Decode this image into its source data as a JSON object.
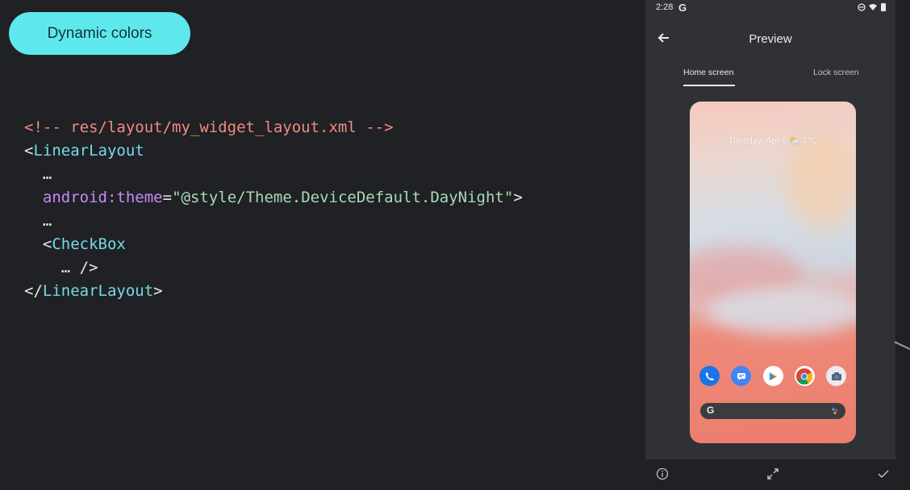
{
  "slide": {
    "badge": "Dynamic colors",
    "code": {
      "line1": "<!-- res/layout/my_widget_layout.xml -->",
      "line2_open": "<",
      "line2_tag": "LinearLayout",
      "line3": "…",
      "line4_attr": "android:theme",
      "line4_eq": "=",
      "line4_value": "\"@style/Theme.DeviceDefault.DayNight\"",
      "line4_close": ">",
      "line5": "…",
      "line6_open": "<",
      "line6_tag": "CheckBox",
      "line7": "… />",
      "line8_open": "</",
      "line8_tag": "LinearLayout",
      "line8_close": ">"
    }
  },
  "phone": {
    "status": {
      "time": "2:28",
      "google": "G"
    },
    "appbar": {
      "title": "Preview"
    },
    "tabs": [
      {
        "label": "Home screen",
        "selected": true
      },
      {
        "label": "Lock screen",
        "selected": false
      }
    ],
    "preview": {
      "date": "Tuesday, Apr 6 ⛅ 7°C",
      "search_logo": "G"
    }
  },
  "colors": {
    "accent": "#5ee8ee",
    "comment": "#f28b82",
    "tag": "#78d9ec",
    "attr": "#c58af9",
    "string": "#a8dab5"
  },
  "icons": [
    "back-arrow-icon",
    "info-icon",
    "fullscreen-icon",
    "check-icon",
    "phone-icon",
    "messages-icon",
    "play-store-icon",
    "chrome-icon",
    "camera-icon",
    "google-g-icon",
    "mic-icon"
  ]
}
